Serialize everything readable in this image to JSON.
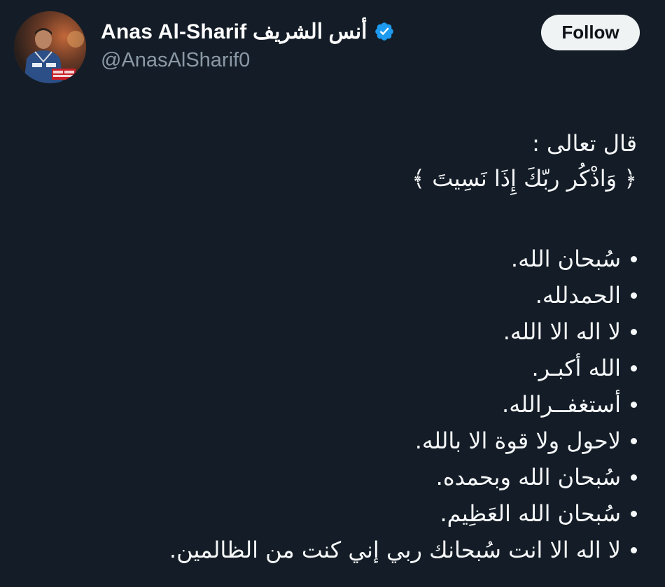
{
  "tweet": {
    "author": {
      "display_name": "Anas Al-Sharif أنس الشريف",
      "handle": "@AnasAlSharif0",
      "verified_icon": "verified-badge-icon",
      "avatar_icon": "avatar"
    },
    "follow_button": {
      "label": "Follow"
    },
    "intro": [
      "قال تعالى :",
      "﴿ وَاذْكُر ربّكَ إِذَا نَسِيتَ ﴾"
    ],
    "bullets": [
      "سُبحان الله.",
      "الحمدلله.",
      "لا اله الا الله.",
      "الله أكبـر.",
      "أستغفــرالله.",
      "لاحول ولا قوة الا بالله.",
      "سُبحان الله وبحمده.",
      "سُبحان الله العَظِيم.",
      "لا اله الا انت سُبحانك ربي إني كنت من الظالمين."
    ]
  },
  "colors": {
    "background": "#141d27",
    "text_primary": "#f5f7f8",
    "text_secondary": "#8b98a5",
    "verified_blue": "#1d9bf0",
    "follow_bg": "#eff3f4",
    "follow_text": "#0f1419"
  }
}
